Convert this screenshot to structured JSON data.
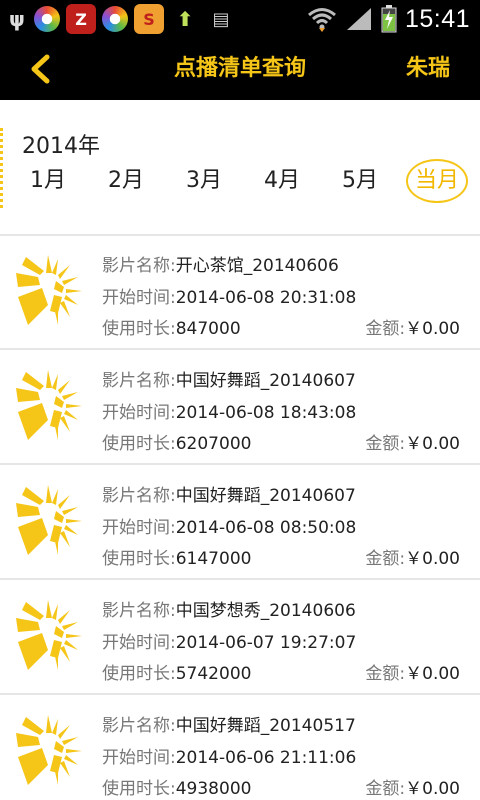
{
  "status_bar": {
    "time": "15:41",
    "icons": [
      "usb-icon",
      "app-circle-icon",
      "z-app-icon",
      "app-circle-icon",
      "s-app-icon",
      "upload-icon",
      "sd-card-icon"
    ]
  },
  "header": {
    "title": "点播清单查询",
    "user": "朱瑞"
  },
  "month_selector": {
    "year": "2014年",
    "months": [
      "1月",
      "2月",
      "3月",
      "4月",
      "5月",
      "当月"
    ],
    "selected": "当月"
  },
  "labels": {
    "film_name": "影片名称:",
    "start_time": "开始时间:",
    "duration": "使用时长:",
    "amount": "金额:"
  },
  "records": [
    {
      "film": "开心茶馆_20140606",
      "start": "2014-06-08 20:31:08",
      "duration": "847000",
      "amount": "￥0.00"
    },
    {
      "film": "中国好舞蹈_20140607",
      "start": "2014-06-08 18:43:08",
      "duration": "6207000",
      "amount": "￥0.00"
    },
    {
      "film": "中国好舞蹈_20140607",
      "start": "2014-06-08 08:50:08",
      "duration": "6147000",
      "amount": "￥0.00"
    },
    {
      "film": "中国梦想秀_20140606",
      "start": "2014-06-07 19:27:07",
      "duration": "5742000",
      "amount": "￥0.00"
    },
    {
      "film": "中国好舞蹈_20140517",
      "start": "2014-06-06 21:11:06",
      "duration": "4938000",
      "amount": "￥0.00"
    }
  ],
  "colors": {
    "accent": "#f5c518",
    "header_bg": "#000000"
  }
}
